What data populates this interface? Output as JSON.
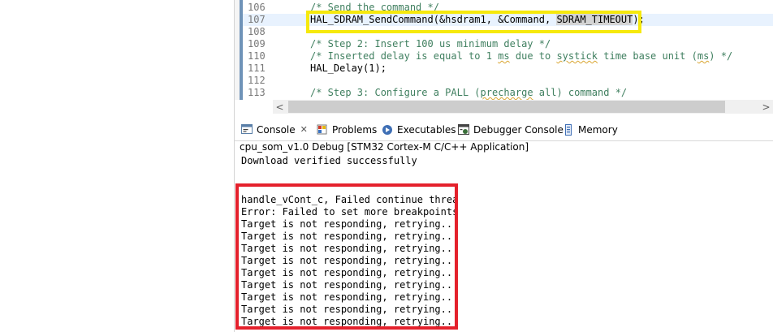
{
  "editor": {
    "lines": [
      {
        "num": "106",
        "code": "/* Send the command */"
      },
      {
        "num": "107",
        "code_before": "HAL_SDRAM_SendCommand(&hsdram1, &Command, ",
        "code_sel": "SDRAM_TIMEOUT",
        "code_after": ");"
      },
      {
        "num": "108",
        "code": ""
      },
      {
        "num": "109",
        "code": "/* Step 2: Insert 100 us minimum delay */"
      },
      {
        "num": "110",
        "code_a": "/* Inserted delay is equal to 1 ",
        "code_ms1": "ms",
        "code_b": " due to ",
        "code_systick": "systick",
        "code_c": " time base unit (",
        "code_ms2": "ms",
        "code_d": ") */"
      },
      {
        "num": "111",
        "code": "HAL_Delay(1);"
      },
      {
        "num": "112",
        "code": ""
      },
      {
        "num": "113",
        "code_a": "/* Step 3: Configure a PALL (",
        "code_pre": "precharge",
        "code_b": " all) command */"
      }
    ]
  },
  "scrollbar": {
    "left_arrow": "<",
    "right_arrow": ">"
  },
  "tabs": {
    "console": "Console",
    "problems": "Problems",
    "executables": "Executables",
    "debugger_console": "Debugger Console",
    "memory": "Memory"
  },
  "console": {
    "title": "cpu_som_v1.0 Debug [STM32 Cortex-M C/C++ Application]",
    "lines_top": [
      "Download verified successfully"
    ],
    "lines_boxed": [
      "handle_vCont_c, Failed continue thread",
      "Error: Failed to set more breakpoints",
      "Target is not responding, retrying...",
      "Target is not responding, retrying...",
      "Target is not responding, retrying...",
      "Target is not responding, retrying...",
      "Target is not responding, retrying...",
      "Target is not responding, retrying...",
      "Target is not responding, retrying...",
      "Target is not responding, retrying...",
      "Target is not responding, retrying..."
    ]
  },
  "colors": {
    "highlight_yellow": "#f6e90d",
    "highlight_red": "#e4212c",
    "comment_green": "#3f7f5f"
  },
  "icons": [
    "console-icon",
    "problems-icon",
    "executables-icon",
    "debugger-console-icon",
    "memory-icon",
    "close-icon"
  ]
}
